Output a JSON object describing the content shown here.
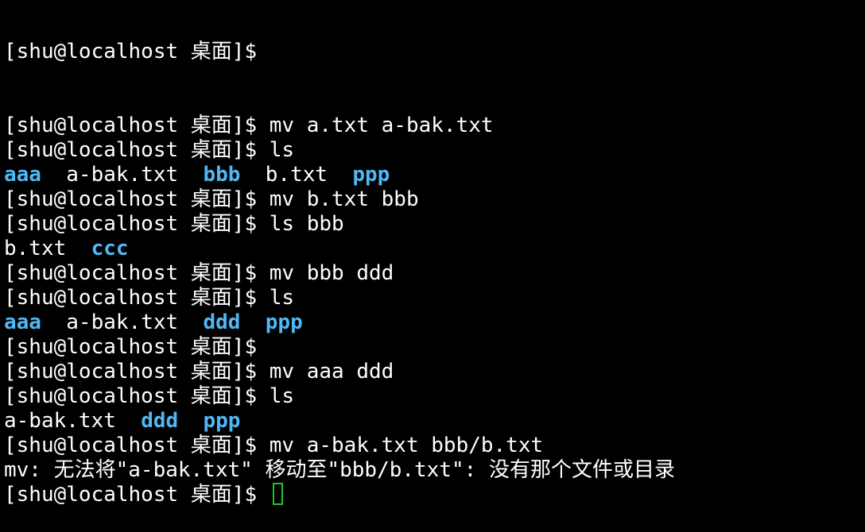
{
  "terminal": {
    "prompt": "[shu@localhost 桌面]$",
    "lines": [
      {
        "type": "prompt",
        "cmd": "mv a.txt a-bak.txt"
      },
      {
        "type": "prompt",
        "cmd": "ls"
      },
      {
        "type": "output",
        "items": [
          {
            "text": "aaa",
            "dir": true
          },
          {
            "text": "a-bak.txt",
            "dir": false
          },
          {
            "text": "bbb",
            "dir": true
          },
          {
            "text": "b.txt",
            "dir": false
          },
          {
            "text": "ppp",
            "dir": true
          }
        ]
      },
      {
        "type": "prompt",
        "cmd": "mv b.txt bbb"
      },
      {
        "type": "prompt",
        "cmd": "ls bbb"
      },
      {
        "type": "output",
        "items": [
          {
            "text": "b.txt",
            "dir": false
          },
          {
            "text": "ccc",
            "dir": true
          }
        ]
      },
      {
        "type": "prompt",
        "cmd": "mv bbb ddd"
      },
      {
        "type": "prompt",
        "cmd": "ls"
      },
      {
        "type": "output",
        "items": [
          {
            "text": "aaa",
            "dir": true
          },
          {
            "text": "a-bak.txt",
            "dir": false
          },
          {
            "text": "ddd",
            "dir": true
          },
          {
            "text": "ppp",
            "dir": true
          }
        ]
      },
      {
        "type": "prompt",
        "cmd": ""
      },
      {
        "type": "prompt",
        "cmd": "mv aaa ddd"
      },
      {
        "type": "prompt",
        "cmd": "ls"
      },
      {
        "type": "output",
        "items": [
          {
            "text": "a-bak.txt",
            "dir": false
          },
          {
            "text": "ddd",
            "dir": true
          },
          {
            "text": "ppp",
            "dir": true
          }
        ]
      },
      {
        "type": "prompt",
        "cmd": "mv a-bak.txt bbb/b.txt"
      },
      {
        "type": "error",
        "text": "mv: 无法将\"a-bak.txt\" 移动至\"bbb/b.txt\": 没有那个文件或目录"
      },
      {
        "type": "prompt",
        "cmd": "",
        "cursor": true
      }
    ],
    "colors": {
      "background": "#000000",
      "foreground": "#ffffff",
      "directory": "#4fb8f5",
      "cursor": "#22c22a"
    }
  }
}
